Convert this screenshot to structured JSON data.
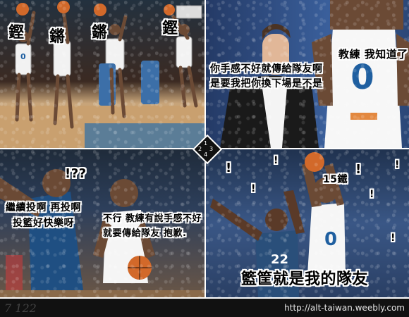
{
  "panel1": {
    "sfx": [
      "鏗",
      "鏘",
      "鏘",
      "鏗"
    ],
    "jersey_number": "0"
  },
  "panel2": {
    "coach_caption_lines": [
      "你手感不好就傳給隊友啊",
      "是要我把你換下場是不是"
    ],
    "player_caption": "教練 我知道了",
    "jersey_number": "0"
  },
  "panel3": {
    "question": "!??",
    "left_caption_lines": [
      "繼續投啊 再投啊",
      "投籃好快樂呀"
    ],
    "right_caption_lines": [
      "不行 教練有說手感不好",
      "就要傳給隊友 抱歉."
    ]
  },
  "panel4": {
    "iron_caption": "15鐵",
    "exclaims": [
      "!",
      "!",
      "!",
      "!",
      "!",
      "!",
      "!"
    ],
    "bottom_caption": "籃筐就是我的隊友",
    "defender_number": "22",
    "shooter_number": "0"
  },
  "footer": {
    "url": "http://alt-taiwan.weebly.com",
    "watermark": "7 122"
  },
  "diamond": [
    "1",
    "2",
    "3",
    "4"
  ]
}
